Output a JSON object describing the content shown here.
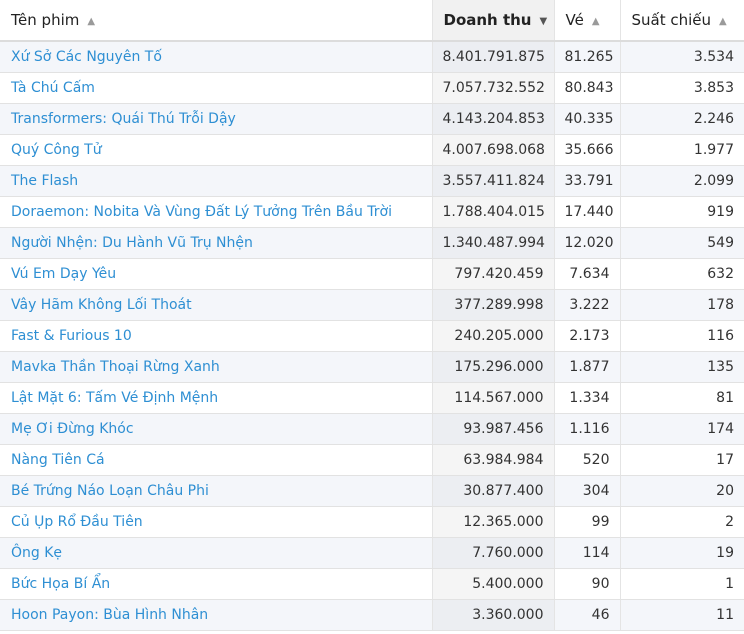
{
  "columns": {
    "title": "Tên phim",
    "revenue": "Doanh thu",
    "tickets": "Vé",
    "screenings": "Suất chiếu"
  },
  "icons": {
    "sort_asc": "▲",
    "sort_desc": "▼"
  },
  "rows": [
    {
      "title": "Xứ Sở Các Nguyên Tố",
      "revenue": "8.401.791.875",
      "tickets": "81.265",
      "screenings": "3.534"
    },
    {
      "title": "Tà Chú Cấm",
      "revenue": "7.057.732.552",
      "tickets": "80.843",
      "screenings": "3.853"
    },
    {
      "title": "Transformers: Quái Thú Trỗi Dậy",
      "revenue": "4.143.204.853",
      "tickets": "40.335",
      "screenings": "2.246"
    },
    {
      "title": "Quý Công Tử",
      "revenue": "4.007.698.068",
      "tickets": "35.666",
      "screenings": "1.977"
    },
    {
      "title": "The Flash",
      "revenue": "3.557.411.824",
      "tickets": "33.791",
      "screenings": "2.099"
    },
    {
      "title": "Doraemon: Nobita Và Vùng Đất Lý Tưởng Trên Bầu Trời",
      "revenue": "1.788.404.015",
      "tickets": "17.440",
      "screenings": "919"
    },
    {
      "title": "Người Nhện: Du Hành Vũ Trụ Nhện",
      "revenue": "1.340.487.994",
      "tickets": "12.020",
      "screenings": "549"
    },
    {
      "title": "Vú Em Dạy Yêu",
      "revenue": "797.420.459",
      "tickets": "7.634",
      "screenings": "632"
    },
    {
      "title": "Vây Hãm Không Lối Thoát",
      "revenue": "377.289.998",
      "tickets": "3.222",
      "screenings": "178"
    },
    {
      "title": "Fast & Furious 10",
      "revenue": "240.205.000",
      "tickets": "2.173",
      "screenings": "116"
    },
    {
      "title": "Mavka Thần Thoại Rừng Xanh",
      "revenue": "175.296.000",
      "tickets": "1.877",
      "screenings": "135"
    },
    {
      "title": "Lật Mặt 6: Tấm Vé Định Mệnh",
      "revenue": "114.567.000",
      "tickets": "1.334",
      "screenings": "81"
    },
    {
      "title": "Mẹ Ơi Đừng Khóc",
      "revenue": "93.987.456",
      "tickets": "1.116",
      "screenings": "174"
    },
    {
      "title": "Nàng Tiên Cá",
      "revenue": "63.984.984",
      "tickets": "520",
      "screenings": "17"
    },
    {
      "title": "Bé Trứng Náo Loạn Châu Phi",
      "revenue": "30.877.400",
      "tickets": "304",
      "screenings": "20"
    },
    {
      "title": "Củ Ụp Rổ Đầu Tiên",
      "revenue": "12.365.000",
      "tickets": "99",
      "screenings": "2"
    },
    {
      "title": "Ông Kẹ",
      "revenue": "7.760.000",
      "tickets": "114",
      "screenings": "19"
    },
    {
      "title": "Bức Họa Bí Ẩn",
      "revenue": "5.400.000",
      "tickets": "90",
      "screenings": "1"
    },
    {
      "title": "Hoon Payon: Bùa Hình Nhân",
      "revenue": "3.360.000",
      "tickets": "46",
      "screenings": "11"
    }
  ]
}
